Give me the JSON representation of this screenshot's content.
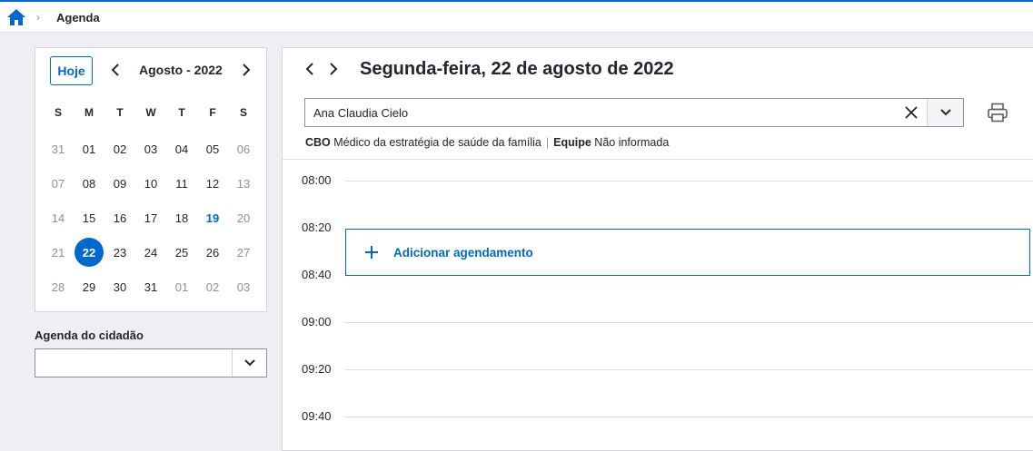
{
  "breadcrumb": {
    "separator": "›",
    "current": "Agenda"
  },
  "calendar": {
    "today_button": "Hoje",
    "month_label": "Agosto - 2022",
    "weekdays": [
      "S",
      "M",
      "T",
      "W",
      "T",
      "F",
      "S"
    ],
    "days": [
      "31",
      "01",
      "02",
      "03",
      "04",
      "05",
      "06",
      "07",
      "08",
      "09",
      "10",
      "11",
      "12",
      "13",
      "14",
      "15",
      "16",
      "17",
      "18",
      "19",
      "20",
      "21",
      "22",
      "23",
      "24",
      "25",
      "26",
      "27",
      "28",
      "29",
      "30",
      "31",
      "01",
      "02",
      "03"
    ],
    "selected_day": "22",
    "current_day": "19"
  },
  "cidadao": {
    "label": "Agenda do cidadão",
    "value": ""
  },
  "main": {
    "title": "Segunda-feira, 22 de agosto de 2022",
    "professional": "Ana Claudia Cielo",
    "cbo_label": "CBO",
    "cbo_value": "Médico da estratégia de saúde da família",
    "info_separator": "|",
    "equipe_label": "Equipe",
    "equipe_value": "Não informada",
    "times": [
      "08:00",
      "08:20",
      "08:40",
      "09:00",
      "09:20",
      "09:40"
    ],
    "add_label": "Adicionar agendamento"
  },
  "colors": {
    "primary": "#0069d0",
    "muted": "#8f8fa3",
    "text": "#24252e",
    "background": "#efeff3"
  }
}
